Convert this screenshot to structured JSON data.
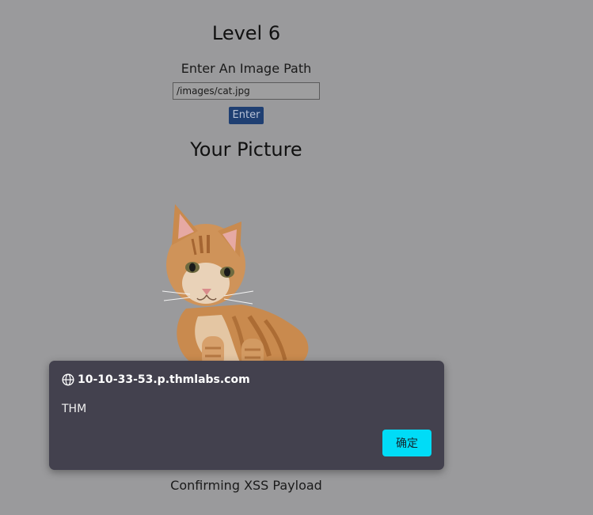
{
  "page": {
    "level_title": "Level 6",
    "prompt_label": "Enter An Image Path",
    "path_input_value": "/images/cat.jpg",
    "enter_button_label": "Enter",
    "picture_heading": "Your Picture",
    "caption": "Confirming XSS Payload"
  },
  "alert_dialog": {
    "origin": "10-10-33-53.p.thmlabs.com",
    "origin_icon": "globe-icon",
    "message": "THM",
    "ok_label": "确定",
    "ok_color": "#00dcf7"
  },
  "colors": {
    "overlay_background": "#9a9a9c",
    "dialog_background": "#43414e",
    "enter_button": "#1f3f72"
  }
}
